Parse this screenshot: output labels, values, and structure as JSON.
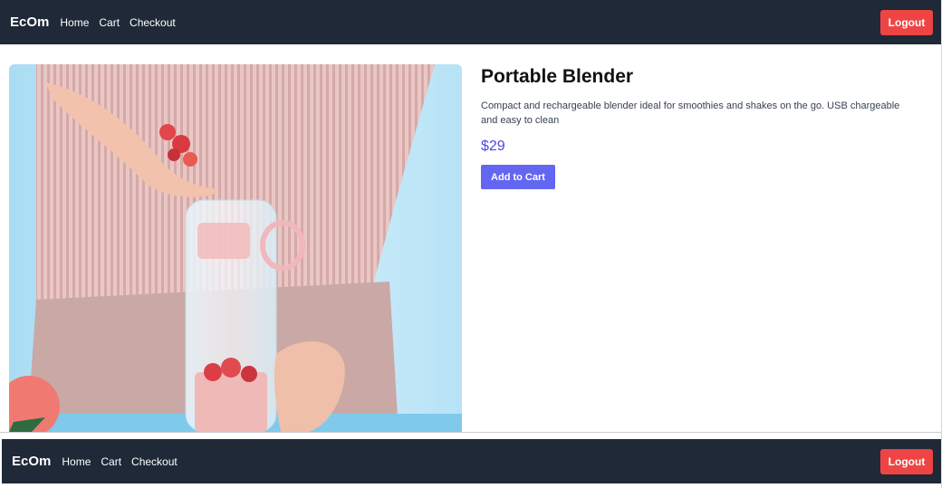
{
  "header": {
    "brand": "EcOm",
    "nav": [
      "Home",
      "Cart",
      "Checkout"
    ],
    "logout_label": "Logout"
  },
  "product": {
    "title": "Portable Blender",
    "description": "Compact and rechargeable blender ideal for smoothies and shakes on the go. USB chargeable and easy to clean",
    "price": "$29",
    "add_to_cart_label": "Add to Cart",
    "image_subject": "product-photo"
  },
  "footer": {
    "brand": "EcOm",
    "nav": [
      "Home",
      "Cart",
      "Checkout"
    ],
    "logout_label": "Logout"
  },
  "colors": {
    "navbar_bg": "#1f2937",
    "logout_bg": "#ef4444",
    "accent": "#6366f1",
    "price": "#4f46e5"
  }
}
